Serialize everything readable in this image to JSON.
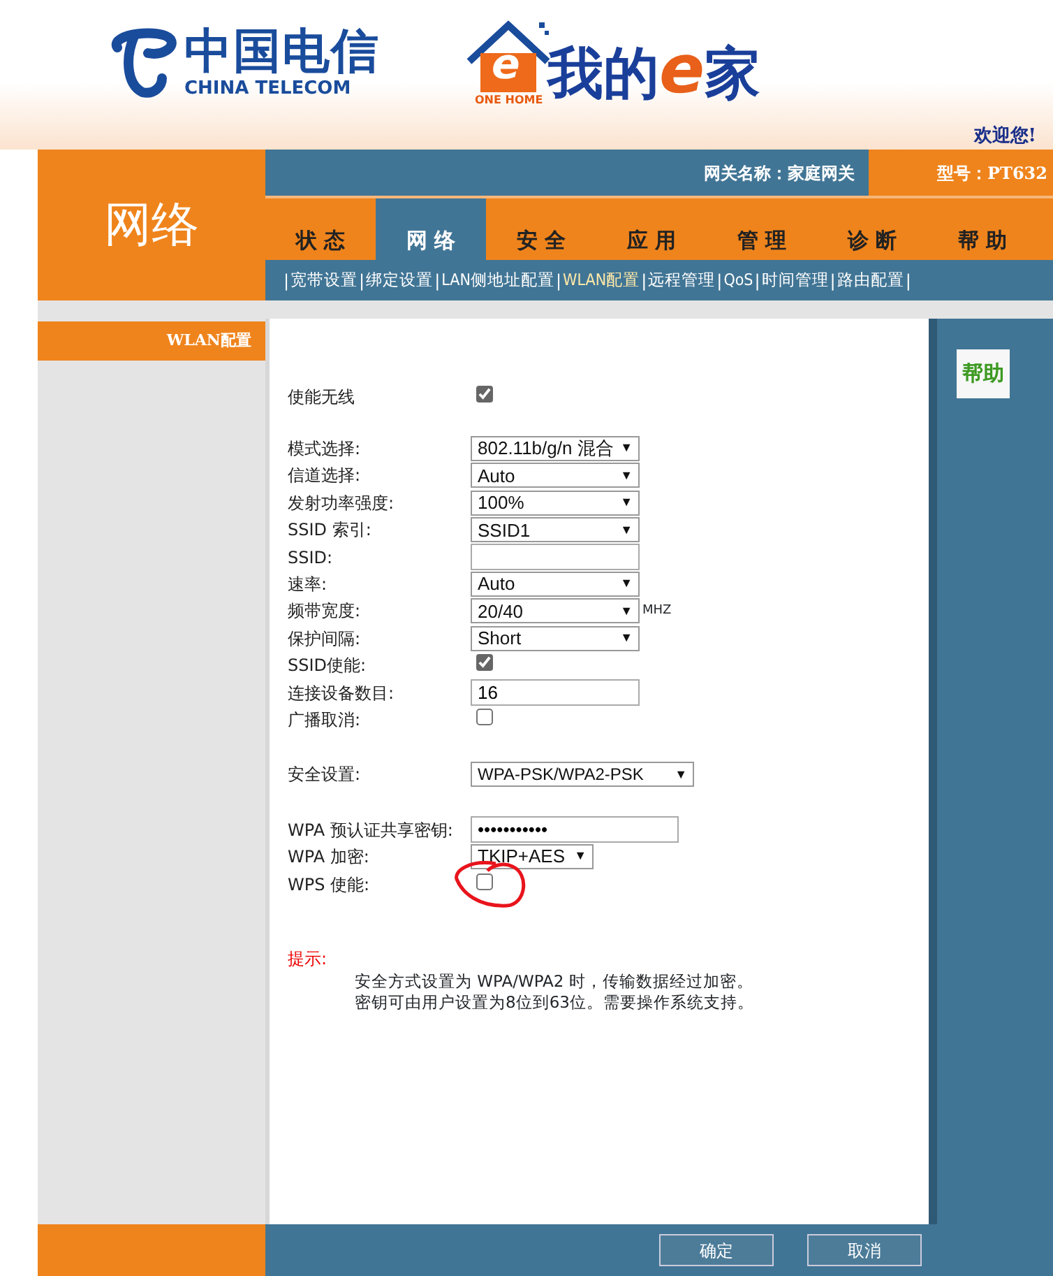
{
  "header": {
    "brand": {
      "chinese": "中国电信",
      "english": "CHINA TELECOM"
    },
    "product": {
      "badge_letter": "e",
      "badge_text": "ONE HOME",
      "title_start": "我的",
      "title_e": "e",
      "title_end": "家"
    },
    "welcome": "欢迎您!"
  },
  "section_title": "网络",
  "info_bar": {
    "gateway": "网关名称：家庭网关",
    "model": "型号：PT632"
  },
  "tabs": [
    {
      "label": "状 态",
      "selected": false
    },
    {
      "label": "网 络",
      "selected": true
    },
    {
      "label": "安 全",
      "selected": false
    },
    {
      "label": "应 用",
      "selected": false
    },
    {
      "label": "管 理",
      "selected": false
    },
    {
      "label": "诊 断",
      "selected": false
    },
    {
      "label": "帮 助",
      "selected": false
    }
  ],
  "subnav": {
    "separator": "|",
    "links": [
      {
        "label": "宽带设置",
        "selected": false
      },
      {
        "label": "绑定设置",
        "selected": false
      },
      {
        "label": "LAN侧地址配置",
        "selected": false
      },
      {
        "label": "WLAN配置",
        "selected": true
      },
      {
        "label": "远程管理",
        "selected": false
      },
      {
        "label": "QoS",
        "selected": false
      },
      {
        "label": "时间管理",
        "selected": false
      },
      {
        "label": "路由配置",
        "selected": false
      }
    ]
  },
  "sidebar": {
    "items": [
      {
        "label": "WLAN配置",
        "selected": true
      }
    ]
  },
  "form": {
    "caret": "▼",
    "groups": [
      {
        "rows": [
          {
            "kind": "checkbox",
            "label": "使能无线",
            "checked": true
          }
        ]
      },
      {
        "rows": [
          {
            "kind": "select",
            "label": "模式选择:",
            "value": "802.11b/g/n 混合"
          },
          {
            "kind": "select",
            "label": "信道选择:",
            "value": "Auto"
          },
          {
            "kind": "select",
            "label": "发射功率强度:",
            "value": "100%"
          },
          {
            "kind": "select",
            "label": "SSID 索引:",
            "value": "SSID1"
          },
          {
            "kind": "text",
            "label": "SSID:"
          },
          {
            "kind": "select",
            "label": "速率:",
            "value": "Auto"
          },
          {
            "kind": "select",
            "label": "频带宽度:",
            "value": "20/40",
            "unit": "MHZ"
          },
          {
            "kind": "select",
            "label": "保护间隔:",
            "value": "Short"
          },
          {
            "kind": "checkbox",
            "label": "SSID使能:",
            "checked": true
          },
          {
            "kind": "text",
            "label": "连接设备数目:",
            "value": "16"
          },
          {
            "kind": "checkbox",
            "label": "广播取消:",
            "checked": false
          }
        ]
      },
      {
        "rows": [
          {
            "kind": "select",
            "label": "安全设置:",
            "value": "WPA-PSK/WPA2-PSK",
            "wide": true
          }
        ]
      },
      {
        "rows": [
          {
            "kind": "password",
            "label": "WPA 预认证共享密钥:",
            "value": "•••••••••••"
          },
          {
            "kind": "select",
            "label": "WPA 加密:",
            "value": "TKIP+AES",
            "short": true
          },
          {
            "kind": "checkbox",
            "label": "WPS 使能:",
            "checked": false,
            "circled": true
          }
        ]
      }
    ]
  },
  "hint": {
    "title": "提示:",
    "lines": [
      "安全方式设置为 WPA/WPA2 时，传输数据经过加密。",
      "密钥可由用户设置为8位到63位。需要操作系统支持。"
    ]
  },
  "help_panel": {
    "title": "帮助"
  },
  "footer": {
    "buttons": [
      "确定",
      "取消"
    ]
  }
}
